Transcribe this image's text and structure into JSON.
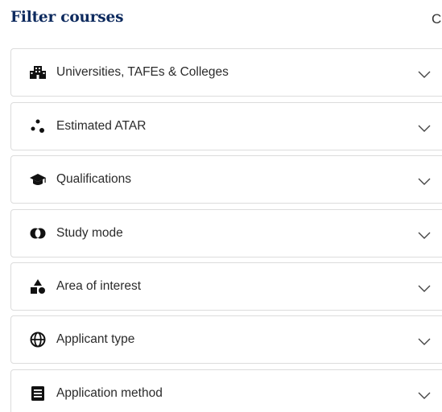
{
  "header": {
    "title": "Filter courses",
    "clear_stub": "C"
  },
  "filters": [
    {
      "label": "Universities, TAFEs & Colleges",
      "icon": "building-icon"
    },
    {
      "label": "Estimated ATAR",
      "icon": "dots-icon"
    },
    {
      "label": "Qualifications",
      "icon": "graduation-cap-icon"
    },
    {
      "label": "Study mode",
      "icon": "overlap-circles-icon"
    },
    {
      "label": "Area of interest",
      "icon": "shapes-icon"
    },
    {
      "label": "Applicant type",
      "icon": "globe-icon"
    },
    {
      "label": "Application method",
      "icon": "form-icon"
    }
  ],
  "colors": {
    "title": "#0d2a5e",
    "border": "#dcdcdc",
    "icon": "#111111"
  }
}
